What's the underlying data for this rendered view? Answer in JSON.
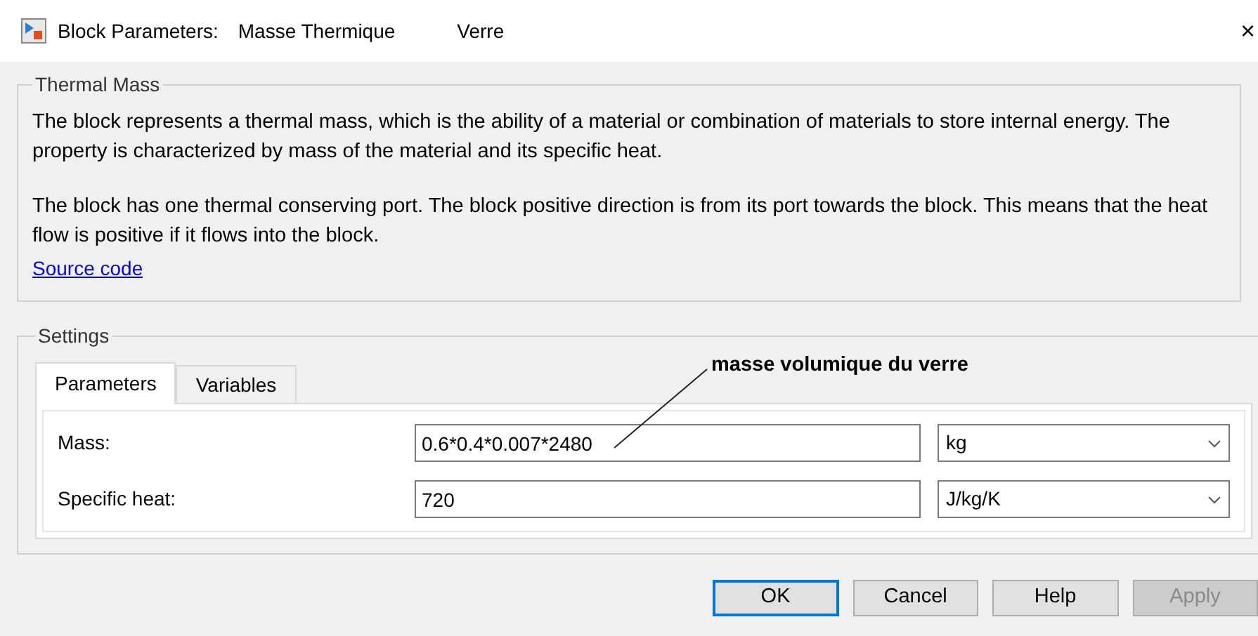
{
  "window": {
    "title": "Block Parameters:",
    "block_name": "Masse Thermique",
    "subtitle": "Verre",
    "close": "×"
  },
  "description": {
    "title": "Thermal Mass",
    "paragraphs": [
      "The block represents a thermal mass, which is the ability of a material or combination of materials to store internal energy. The property is characterized by mass of the material and its specific heat.",
      "The block has one thermal conserving port. The block positive direction is from its port towards the block. This means that the heat flow is positive if it flows into the block."
    ],
    "link": "Source code"
  },
  "settings": {
    "title": "Settings",
    "tabs": [
      {
        "label": "Parameters",
        "selected": true
      },
      {
        "label": "Variables",
        "selected": false
      }
    ],
    "parameters": [
      {
        "label": "Mass:",
        "value": "0.6*0.4*0.007*2480",
        "unit": "kg"
      },
      {
        "label": "Specific heat:",
        "value": "720",
        "unit": "J/kg/K"
      }
    ]
  },
  "annotation": "masse volumique du verre",
  "buttons": [
    {
      "label": "OK",
      "default": true,
      "disabled": false
    },
    {
      "label": "Cancel",
      "default": false,
      "disabled": false
    },
    {
      "label": "Help",
      "default": false,
      "disabled": false
    },
    {
      "label": "Apply",
      "default": false,
      "disabled": true
    }
  ]
}
